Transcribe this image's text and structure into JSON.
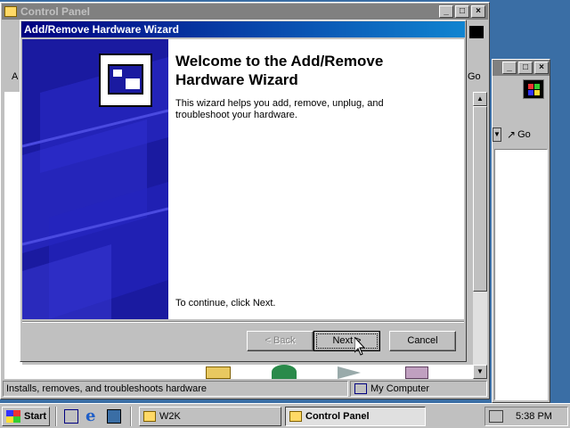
{
  "background_window": {
    "title": "",
    "toolbar": {
      "go_label": "Go"
    }
  },
  "control_panel": {
    "title": "Control Panel",
    "toolbar_fragment": "A",
    "address_fragment": "Go",
    "status_text": "Installs, removes, and troubleshoots hardware",
    "status_zone": "My Computer"
  },
  "wizard": {
    "title": "Add/Remove Hardware Wizard",
    "heading": "Welcome to the Add/Remove Hardware Wizard",
    "description": "This wizard helps you add, remove, unplug, and troubleshoot your hardware.",
    "continue_text": "To continue, click Next.",
    "buttons": {
      "back": "< Back",
      "next": "Next >",
      "cancel": "Cancel"
    }
  },
  "taskbar": {
    "start_label": "Start",
    "items": [
      {
        "label": "W2K"
      },
      {
        "label": "Control Panel"
      }
    ],
    "clock": "5:38 PM"
  },
  "colors": {
    "desktop": "#3a6ea5",
    "active_title": "#000080",
    "wizard_sidebar": "#1a1aa0"
  }
}
